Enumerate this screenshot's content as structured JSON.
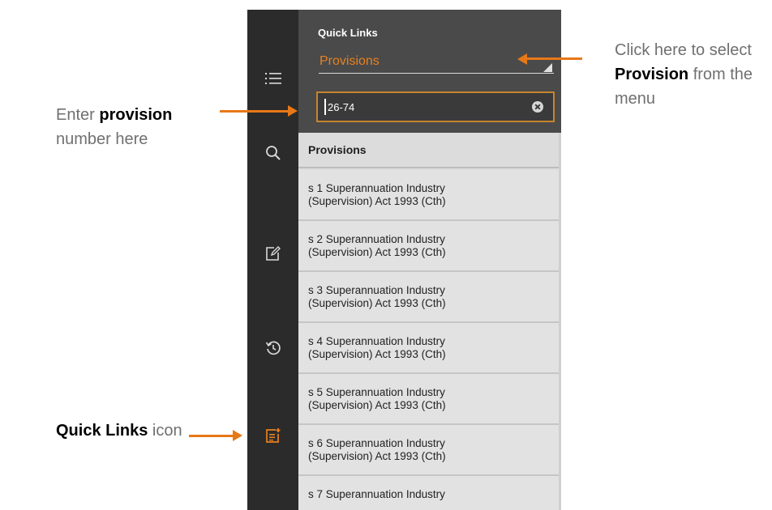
{
  "sidebar": {
    "icons": [
      {
        "name": "list-menu-icon"
      },
      {
        "name": "search-icon"
      },
      {
        "name": "edit-note-icon"
      },
      {
        "name": "history-icon"
      },
      {
        "name": "quick-links-icon",
        "active": true,
        "color": "#e8811f"
      }
    ]
  },
  "panel": {
    "title": "Quick Links",
    "dropdown": {
      "selected": "Provisions"
    },
    "search": {
      "value": "26-74",
      "placeholder": ""
    },
    "list_heading": "Provisions",
    "results": [
      {
        "line1": "s 1 Superannuation Industry",
        "line2": "(Supervision) Act 1993 (Cth)"
      },
      {
        "line1": "s 2 Superannuation Industry",
        "line2": "(Supervision) Act 1993 (Cth)"
      },
      {
        "line1": "s 3 Superannuation Industry",
        "line2": "(Supervision) Act 1993 (Cth)"
      },
      {
        "line1": "s 4 Superannuation Industry",
        "line2": "(Supervision) Act 1993 (Cth)"
      },
      {
        "line1": "s 5 Superannuation Industry",
        "line2": "(Supervision) Act 1993 (Cth)"
      },
      {
        "line1": "s 6 Superannuation Industry",
        "line2": "(Supervision) Act 1993 (Cth)"
      },
      {
        "line1": "s 7 Superannuation Industry",
        "line2": ""
      }
    ]
  },
  "annotations": {
    "enter_provision": {
      "prefix": "Enter ",
      "bold": "provision",
      "suffix": "number here"
    },
    "select_provision": {
      "line1": "Click here to select",
      "bold": "Provision",
      "after_bold": " from the",
      "line3": "menu"
    },
    "quick_links": {
      "bold": "Quick Links",
      "suffix": " icon"
    }
  },
  "colors": {
    "accent": "#e8811f",
    "arrow": "#e77817",
    "rail_bg": "#2b2b2b",
    "header_bg": "#4a4a4a",
    "list_bg": "#e2e2e2"
  }
}
